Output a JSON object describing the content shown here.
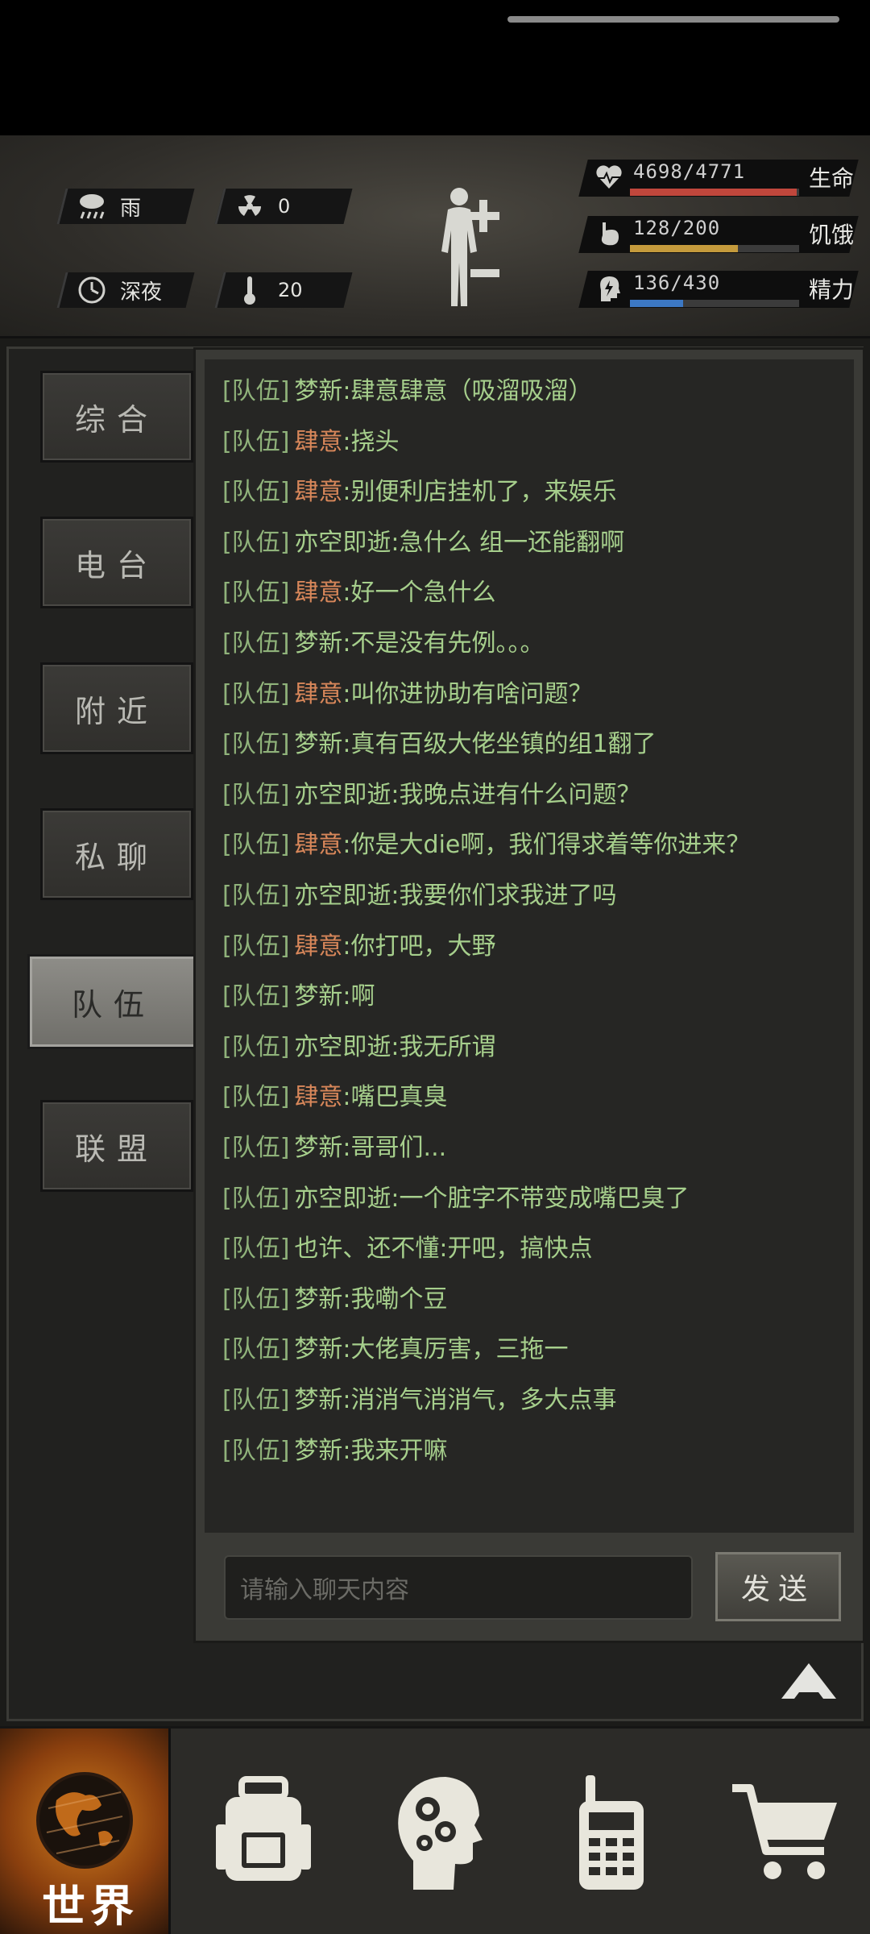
{
  "hud": {
    "weather": "雨",
    "radiation": "0",
    "time_of_day": "深夜",
    "temperature": "20",
    "health": {
      "value": "4698/4771",
      "label": "生命",
      "fraction": 0.985,
      "color": "#c0473c"
    },
    "hunger": {
      "value": "128/200",
      "label": "饥饿",
      "fraction": 0.64,
      "color": "#c49a3c"
    },
    "energy": {
      "value": "136/430",
      "label": "精力",
      "fraction": 0.316,
      "color": "#3c78c4"
    }
  },
  "tabs": [
    {
      "label": "综合",
      "active": false
    },
    {
      "label": "电台",
      "active": false
    },
    {
      "label": "附近",
      "active": false
    },
    {
      "label": "私聊",
      "active": false
    },
    {
      "label": "队伍",
      "active": true
    },
    {
      "label": "联盟",
      "active": false
    }
  ],
  "chat": {
    "messages": [
      {
        "tag": "[队伍]",
        "nick": "梦新",
        "leader": false,
        "text": ":肆意肆意（吸溜吸溜）"
      },
      {
        "tag": "[队伍]",
        "nick": "肆意",
        "leader": true,
        "text": ":挠头"
      },
      {
        "tag": "[队伍]",
        "nick": "肆意",
        "leader": true,
        "text": ":别便利店挂机了，来娱乐"
      },
      {
        "tag": "[队伍]",
        "nick": "亦空即逝",
        "leader": false,
        "text": ":急什么 组一还能翻啊"
      },
      {
        "tag": "[队伍]",
        "nick": "肆意",
        "leader": true,
        "text": ":好一个急什么"
      },
      {
        "tag": "[队伍]",
        "nick": "梦新",
        "leader": false,
        "text": ":不是没有先例。。。"
      },
      {
        "tag": "[队伍]",
        "nick": "肆意",
        "leader": true,
        "text": ":叫你进协助有啥问题？"
      },
      {
        "tag": "[队伍]",
        "nick": "梦新",
        "leader": false,
        "text": ":真有百级大佬坐镇的组1翻了"
      },
      {
        "tag": "[队伍]",
        "nick": "亦空即逝",
        "leader": false,
        "text": ":我晚点进有什么问题？"
      },
      {
        "tag": "[队伍]",
        "nick": "肆意",
        "leader": true,
        "text": ":你是大die啊，我们得求着等你进来？"
      },
      {
        "tag": "[队伍]",
        "nick": "亦空即逝",
        "leader": false,
        "text": ":我要你们求我进了吗"
      },
      {
        "tag": "[队伍]",
        "nick": "肆意",
        "leader": true,
        "text": ":你打吧，大野"
      },
      {
        "tag": "[队伍]",
        "nick": "梦新",
        "leader": false,
        "text": ":啊"
      },
      {
        "tag": "[队伍]",
        "nick": "亦空即逝",
        "leader": false,
        "text": ":我无所谓"
      },
      {
        "tag": "[队伍]",
        "nick": "肆意",
        "leader": true,
        "text": ":嘴巴真臭"
      },
      {
        "tag": "[队伍]",
        "nick": "梦新",
        "leader": false,
        "text": ":哥哥们..."
      },
      {
        "tag": "[队伍]",
        "nick": "亦空即逝",
        "leader": false,
        "text": ":一个脏字不带变成嘴巴臭了"
      },
      {
        "tag": "[队伍]",
        "nick": "也许、还不懂",
        "leader": false,
        "text": ":开吧，搞快点"
      },
      {
        "tag": "[队伍]",
        "nick": "梦新",
        "leader": false,
        "text": ":我嘞个豆"
      },
      {
        "tag": "[队伍]",
        "nick": "梦新",
        "leader": false,
        "text": ":大佬真厉害，三拖一"
      },
      {
        "tag": "[队伍]",
        "nick": "梦新",
        "leader": false,
        "text": ":消消气消消气，多大点事"
      },
      {
        "tag": "[队伍]",
        "nick": "梦新",
        "leader": false,
        "text": ":我来开嘛"
      }
    ],
    "input_placeholder": "请输入聊天内容",
    "send_label": "发送"
  },
  "nav": {
    "world_label": "世界",
    "items": [
      "backpack-icon",
      "skills-head-icon",
      "radio-icon",
      "shop-cart-icon"
    ]
  }
}
